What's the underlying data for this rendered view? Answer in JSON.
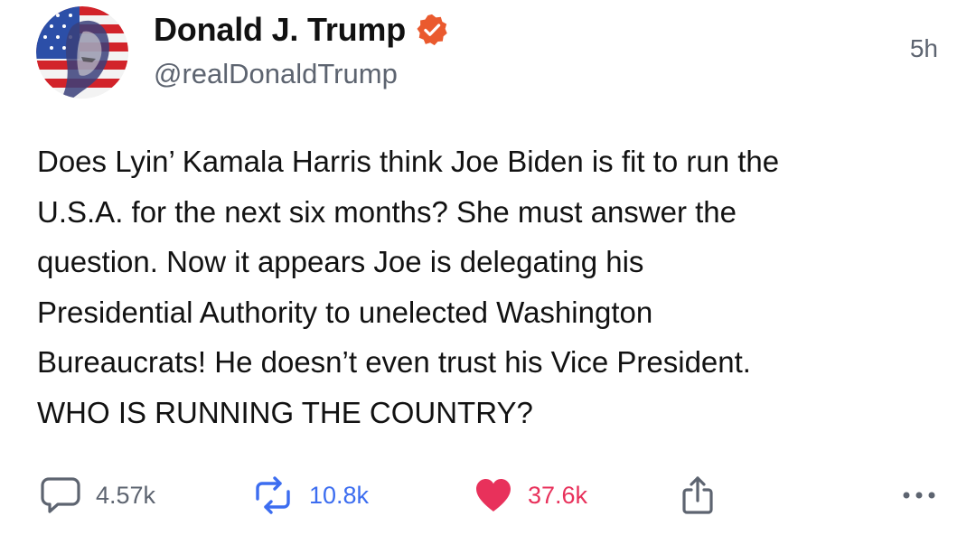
{
  "post": {
    "author": {
      "display_name": "Donald J. Trump",
      "handle": "@realDonaldTrump",
      "verified": true,
      "avatar_icon": "patriotic-portrait-avatar"
    },
    "timestamp": "5h",
    "text": "Does Lyin’ Kamala Harris think Joe Biden is fit to run the\nU.S.A. for the next six months? She must answer the\nquestion. Now it appears Joe is delegating his\nPresidential Authority to unelected Washington\nBureaucrats! He doesn’t even trust his Vice President.\nWHO IS RUNNING THE COUNTRY?",
    "actions": {
      "replies": {
        "icon": "reply-bubble-icon",
        "count": "4.57k"
      },
      "retruths": {
        "icon": "retruth-arrows-icon",
        "count": "10.8k",
        "color": "#3c6df0"
      },
      "likes": {
        "icon": "heart-filled-icon",
        "count": "37.6k",
        "color": "#e8315b"
      },
      "share": {
        "icon": "share-icon"
      },
      "more": {
        "icon": "more-horizontal-icon"
      }
    },
    "colors": {
      "verified_badge": "#ea5a2e",
      "secondary_text": "#5d6470"
    }
  }
}
